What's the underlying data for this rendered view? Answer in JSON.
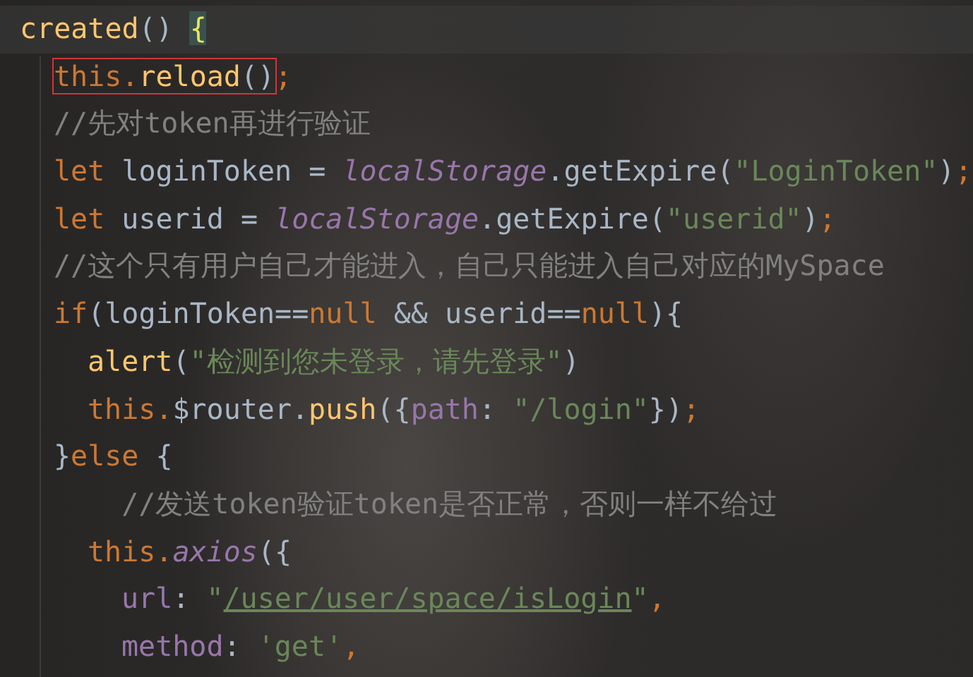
{
  "editor": {
    "lines": [
      {
        "current": true,
        "segments": [
          {
            "kind": "function",
            "text": "created"
          },
          {
            "kind": "plain",
            "text": "() "
          },
          {
            "kind": "brace",
            "text": "{",
            "matched": true
          }
        ],
        "children": [
          {
            "current": false,
            "segments": [
              {
                "kind": "mark",
                "tokens": [
                  {
                    "kind": "keyword",
                    "text": "this."
                  },
                  {
                    "kind": "function",
                    "text": "reload"
                  },
                  {
                    "kind": "plain",
                    "text": "()"
                  }
                ]
              },
              {
                "kind": "keyword",
                "text": ";"
              }
            ]
          },
          {
            "current": false,
            "segments": [
              {
                "kind": "comment",
                "text": "//先对token再进行验证"
              }
            ]
          },
          {
            "current": false,
            "segments": [
              {
                "kind": "keyword",
                "text": "let"
              },
              {
                "kind": "plain",
                "text": " loginToken = "
              },
              {
                "kind": "static",
                "text": "localStorage"
              },
              {
                "kind": "plain",
                "text": ".getExpire("
              },
              {
                "kind": "string",
                "text": "\"LoginToken\""
              },
              {
                "kind": "plain",
                "text": ")"
              },
              {
                "kind": "keyword",
                "text": ";"
              }
            ]
          },
          {
            "current": false,
            "segments": [
              {
                "kind": "keyword",
                "text": "let"
              },
              {
                "kind": "plain",
                "text": " userid = "
              },
              {
                "kind": "static",
                "text": "localStorage"
              },
              {
                "kind": "plain",
                "text": ".getExpire("
              },
              {
                "kind": "string",
                "text": "\"userid\""
              },
              {
                "kind": "plain",
                "text": ")"
              },
              {
                "kind": "keyword",
                "text": ";"
              }
            ]
          },
          {
            "current": false,
            "segments": [
              {
                "kind": "comment",
                "text": "//这个只有用户自己才能进入，自己只能进入自己对应的MySpace"
              }
            ]
          },
          {
            "current": false,
            "segments": [
              {
                "kind": "keyword",
                "text": "if"
              },
              {
                "kind": "plain",
                "text": "(loginToken=="
              },
              {
                "kind": "keyword",
                "text": "null"
              },
              {
                "kind": "plain",
                "text": " && userid=="
              },
              {
                "kind": "keyword",
                "text": "null"
              },
              {
                "kind": "plain",
                "text": "){"
              }
            ],
            "children": [
              {
                "current": false,
                "segments": [
                  {
                    "kind": "function",
                    "text": "alert"
                  },
                  {
                    "kind": "plain",
                    "text": "("
                  },
                  {
                    "kind": "string",
                    "text": "\"检测到您未登录，请先登录\""
                  },
                  {
                    "kind": "plain",
                    "text": ")"
                  }
                ]
              },
              {
                "current": false,
                "segments": [
                  {
                    "kind": "keyword",
                    "text": "this."
                  },
                  {
                    "kind": "plain",
                    "text": "$router."
                  },
                  {
                    "kind": "function",
                    "text": "push"
                  },
                  {
                    "kind": "plain",
                    "text": "({"
                  },
                  {
                    "kind": "field",
                    "text": "path"
                  },
                  {
                    "kind": "plain",
                    "text": ": "
                  },
                  {
                    "kind": "string",
                    "text": "\"/login\""
                  },
                  {
                    "kind": "plain",
                    "text": "})"
                  },
                  {
                    "kind": "keyword",
                    "text": ";"
                  }
                ]
              }
            ]
          },
          {
            "current": false,
            "segments": [
              {
                "kind": "plain",
                "text": "}"
              },
              {
                "kind": "keyword",
                "text": "else"
              },
              {
                "kind": "plain",
                "text": " {"
              }
            ],
            "children": [
              {
                "current": false,
                "segments": [
                  {
                    "kind": "comment",
                    "text": "  //发送token验证token是否正常，否则一样不给过"
                  }
                ]
              },
              {
                "current": false,
                "segments": [
                  {
                    "kind": "keyword",
                    "text": "this."
                  },
                  {
                    "kind": "static",
                    "text": "axios"
                  },
                  {
                    "kind": "plain",
                    "text": "({"
                  }
                ],
                "children": [
                  {
                    "current": false,
                    "segments": [
                      {
                        "kind": "field",
                        "text": "url"
                      },
                      {
                        "kind": "plain",
                        "text": ": "
                      },
                      {
                        "kind": "string",
                        "text": "\""
                      },
                      {
                        "kind": "url",
                        "text": "/user/user/space/isLogin"
                      },
                      {
                        "kind": "string",
                        "text": "\""
                      },
                      {
                        "kind": "keyword",
                        "text": ","
                      }
                    ]
                  },
                  {
                    "current": false,
                    "segments": [
                      {
                        "kind": "field",
                        "text": "method"
                      },
                      {
                        "kind": "plain",
                        "text": ": "
                      },
                      {
                        "kind": "string",
                        "text": "'get'"
                      },
                      {
                        "kind": "keyword",
                        "text": ","
                      }
                    ]
                  }
                ]
              }
            ]
          }
        ]
      }
    ]
  }
}
